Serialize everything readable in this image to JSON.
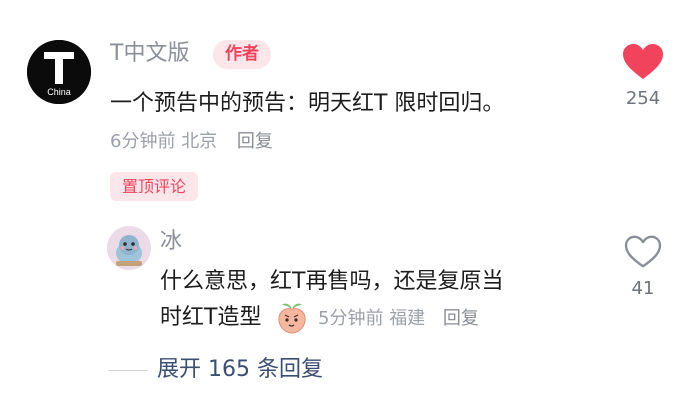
{
  "main_comment": {
    "avatar_logo_letter": "T",
    "avatar_logo_text": "China",
    "username": "T中文版",
    "author_badge": "作者",
    "text": "一个预告中的预告：明天红T 限时回归。",
    "time": "6分钟前",
    "location": "北京",
    "reply_label": "回复",
    "pinned_label": "置顶评论",
    "like_count": "254",
    "like_icon": "heart-filled-icon",
    "like_color": "#f2435d"
  },
  "reply_comment": {
    "username": "冰",
    "text_line_1": "什么意思，红T再售吗，还是复原当",
    "text_line_2": "时红T造型",
    "emoji_icon": "peach-emoji-icon",
    "time": "5分钟前",
    "location": "福建",
    "reply_label": "回复",
    "like_count": "41",
    "like_icon": "heart-outline-icon"
  },
  "expand": {
    "label": "展开 165 条回复"
  }
}
